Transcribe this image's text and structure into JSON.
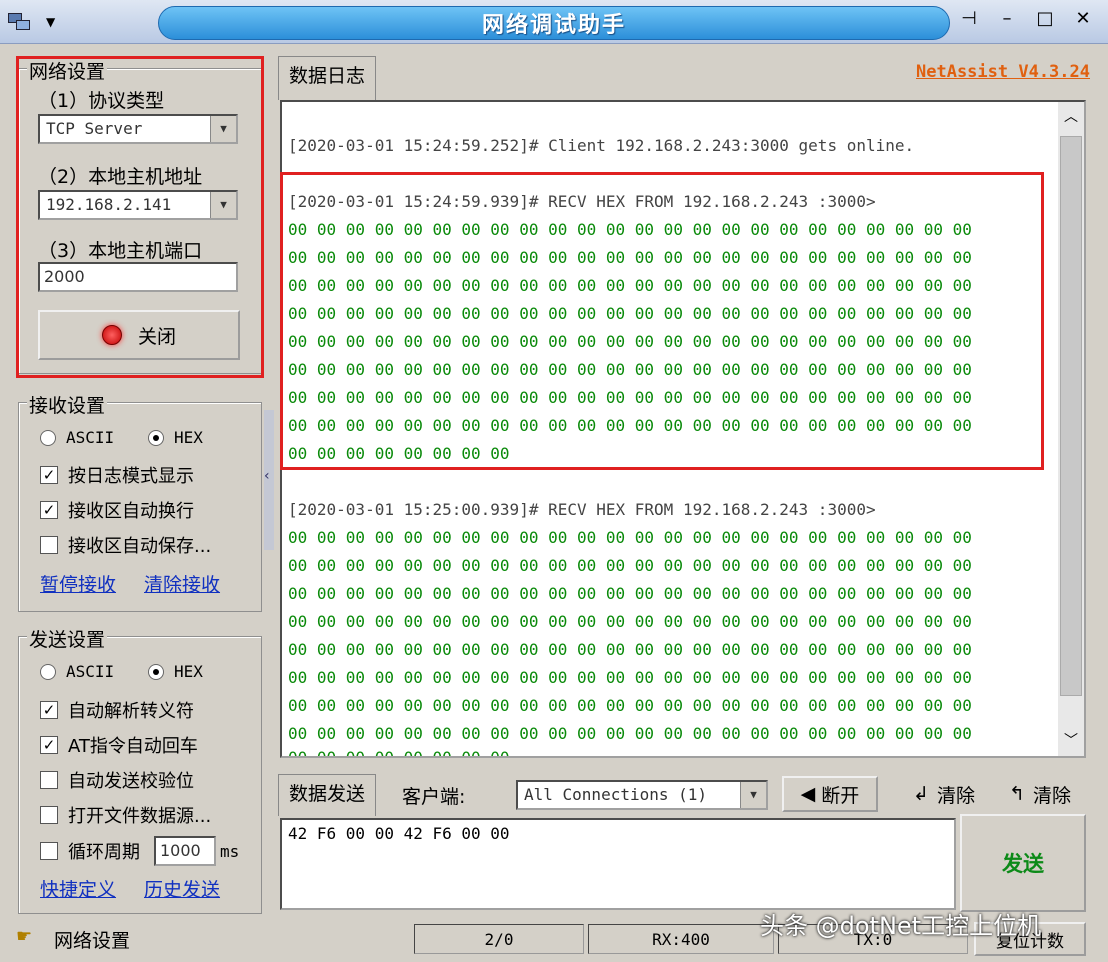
{
  "window": {
    "title": "网络调试助手",
    "brand": "NetAssist V4.3.24"
  },
  "network": {
    "group_title": "网络设置",
    "protocol_label": "（1）协议类型",
    "protocol_value": "TCP Server",
    "host_label": "（2）本地主机地址",
    "host_value": "192.168.2.141",
    "port_label": "（3）本地主机端口",
    "port_value": "2000",
    "close_button": "关闭"
  },
  "receive": {
    "group_title": "接收设置",
    "ascii": "ASCII",
    "hex": "HEX",
    "log_mode": "按日志模式显示",
    "auto_wrap": "接收区自动换行",
    "auto_save": "接收区自动保存...",
    "pause": "暂停接收",
    "clear": "清除接收"
  },
  "send": {
    "group_title": "发送设置",
    "ascii": "ASCII",
    "hex": "HEX",
    "escape": "自动解析转义符",
    "at_cr": "AT指令自动回车",
    "checksum": "自动发送校验位",
    "file_source": "打开文件数据源...",
    "cycle": "循环周期",
    "cycle_value": "1000",
    "cycle_unit": "ms",
    "shortcut": "快捷定义",
    "history": "历史发送"
  },
  "log": {
    "tab": "数据日志",
    "online": "[2020-03-01 15:24:59.252]# Client 192.168.2.243:3000 gets online.",
    "recv1_header": "[2020-03-01 15:24:59.939]# RECV HEX FROM 192.168.2.243 :3000>",
    "recv2_header": "[2020-03-01 15:25:00.939]# RECV HEX FROM 192.168.2.243 :3000>",
    "hex_full_row": "00 00 00 00 00 00 00 00 00 00 00 00 00 00 00 00 00 00 00 00 00 00 00 00",
    "hex_last_row": "00 00 00 00 00 00 00 00"
  },
  "sendbar": {
    "tab": "数据发送",
    "client_label": "客户端:",
    "connections": "All Connections (1)",
    "disconnect": "断开",
    "clear1": "清除",
    "clear2": "清除",
    "payload": "42 F6 00 00 42 F6 00 00",
    "send_button": "发送"
  },
  "status": {
    "left": "网络设置",
    "count": "2/0",
    "rx": "RX:400",
    "tx": "TX:0",
    "reset": "复位计数"
  },
  "watermark": "头条 @dotNet工控上位机"
}
